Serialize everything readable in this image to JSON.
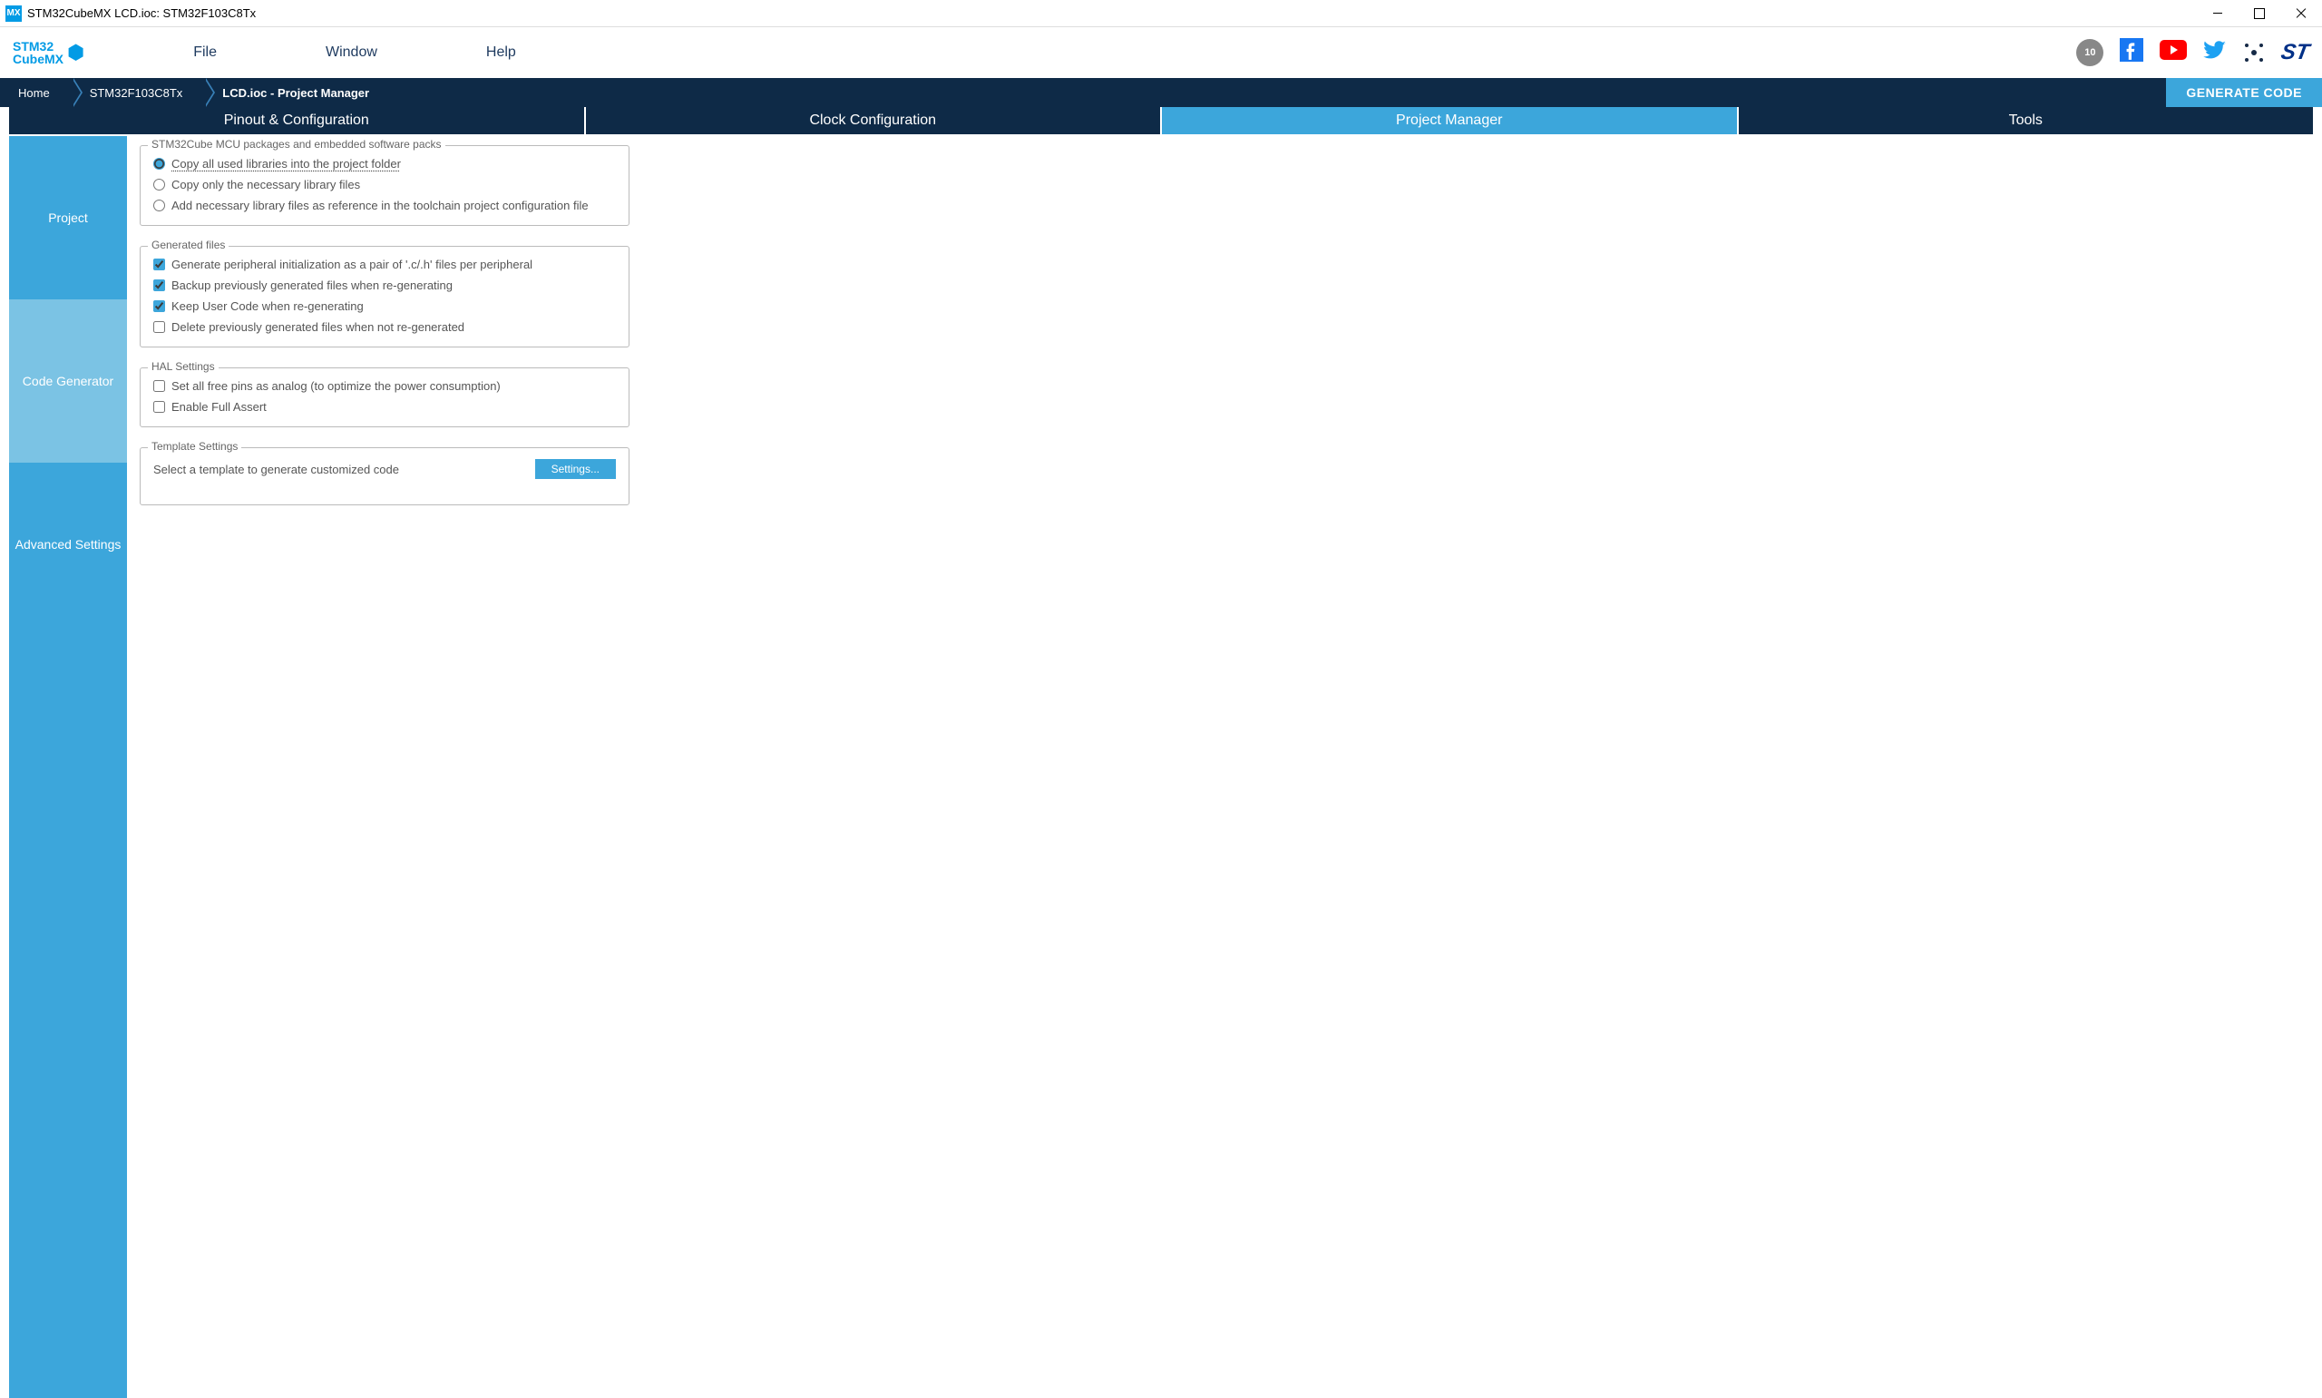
{
  "titlebar": {
    "title": "STM32CubeMX LCD.ioc: STM32F103C8Tx",
    "icon_label": "MX"
  },
  "logo": {
    "line1": "STM32",
    "line2": "CubeMX"
  },
  "menu": {
    "file": "File",
    "window": "Window",
    "help": "Help"
  },
  "badge": "10",
  "breadcrumb": {
    "home": "Home",
    "device": "STM32F103C8Tx",
    "current": "LCD.ioc - Project Manager",
    "generate": "GENERATE CODE"
  },
  "tabs": {
    "pinout": "Pinout & Configuration",
    "clock": "Clock Configuration",
    "project": "Project Manager",
    "tools": "Tools"
  },
  "sidebar": {
    "project": "Project",
    "code_generator": "Code Generator",
    "advanced": "Advanced Settings"
  },
  "packages": {
    "legend": "STM32Cube MCU packages and embedded software packs",
    "opt1": "Copy all used libraries into the project folder",
    "opt2": "Copy only the necessary library files",
    "opt3": "Add necessary library files as reference in the toolchain project configuration file"
  },
  "generated": {
    "legend": "Generated files",
    "chk1": "Generate peripheral initialization as a pair of '.c/.h' files per peripheral",
    "chk2": "Backup previously generated files when re-generating",
    "chk3": "Keep User Code when re-generating",
    "chk4": "Delete previously generated files when not re-generated"
  },
  "hal": {
    "legend": "HAL Settings",
    "chk1": "Set all free pins as analog (to optimize the power consumption)",
    "chk2": "Enable Full Assert"
  },
  "template": {
    "legend": "Template Settings",
    "label": "Select a template to generate customized code",
    "button": "Settings..."
  }
}
